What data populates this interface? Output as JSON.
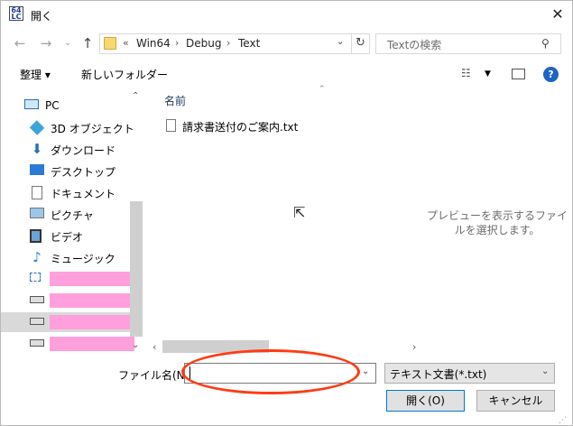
{
  "window": {
    "title": "開く",
    "app_icon_text": "64 LC"
  },
  "nav": {
    "path": [
      "Win64",
      "Debug",
      "Text"
    ],
    "path_prefix": "«",
    "search_placeholder": "Textの検索"
  },
  "toolbar": {
    "organize": "整理 ▾",
    "new_folder": "新しいフォルダー"
  },
  "sidebar": {
    "items": [
      {
        "label": "PC",
        "icon": "pc-icon"
      },
      {
        "label": "3D オブジェクト",
        "icon": "3d-objects-icon"
      },
      {
        "label": "ダウンロード",
        "icon": "download-icon"
      },
      {
        "label": "デスクトップ",
        "icon": "desktop-icon"
      },
      {
        "label": "ドキュメント",
        "icon": "document-icon"
      },
      {
        "label": "ピクチャ",
        "icon": "picture-icon"
      },
      {
        "label": "ビデオ",
        "icon": "video-icon"
      },
      {
        "label": "ミュージック",
        "icon": "music-icon"
      }
    ],
    "redacted_items": [
      {
        "icon": "network-icon",
        "suffix": ""
      },
      {
        "icon": "drive-icon",
        "suffix": ""
      },
      {
        "icon": "drive-icon",
        "suffix": ")"
      },
      {
        "icon": "drive-icon",
        "suffix": ""
      }
    ]
  },
  "file_list": {
    "column_name": "名前",
    "files": [
      {
        "name": "請求書送付のご案内.txt",
        "icon": "text-file-icon"
      }
    ]
  },
  "preview_text": "プレビューを表示するファイルを選択します。",
  "bottom": {
    "filename_label": "ファイル名(N):",
    "filename_value": "",
    "filetype_value": "テキスト文書(*.txt)",
    "open_button": "開く(O)",
    "cancel_button": "キャンセル"
  },
  "colors": {
    "accent": "#0078d7",
    "highlight_ellipse": "#ff3b14",
    "redaction": "#ff9fdc"
  }
}
